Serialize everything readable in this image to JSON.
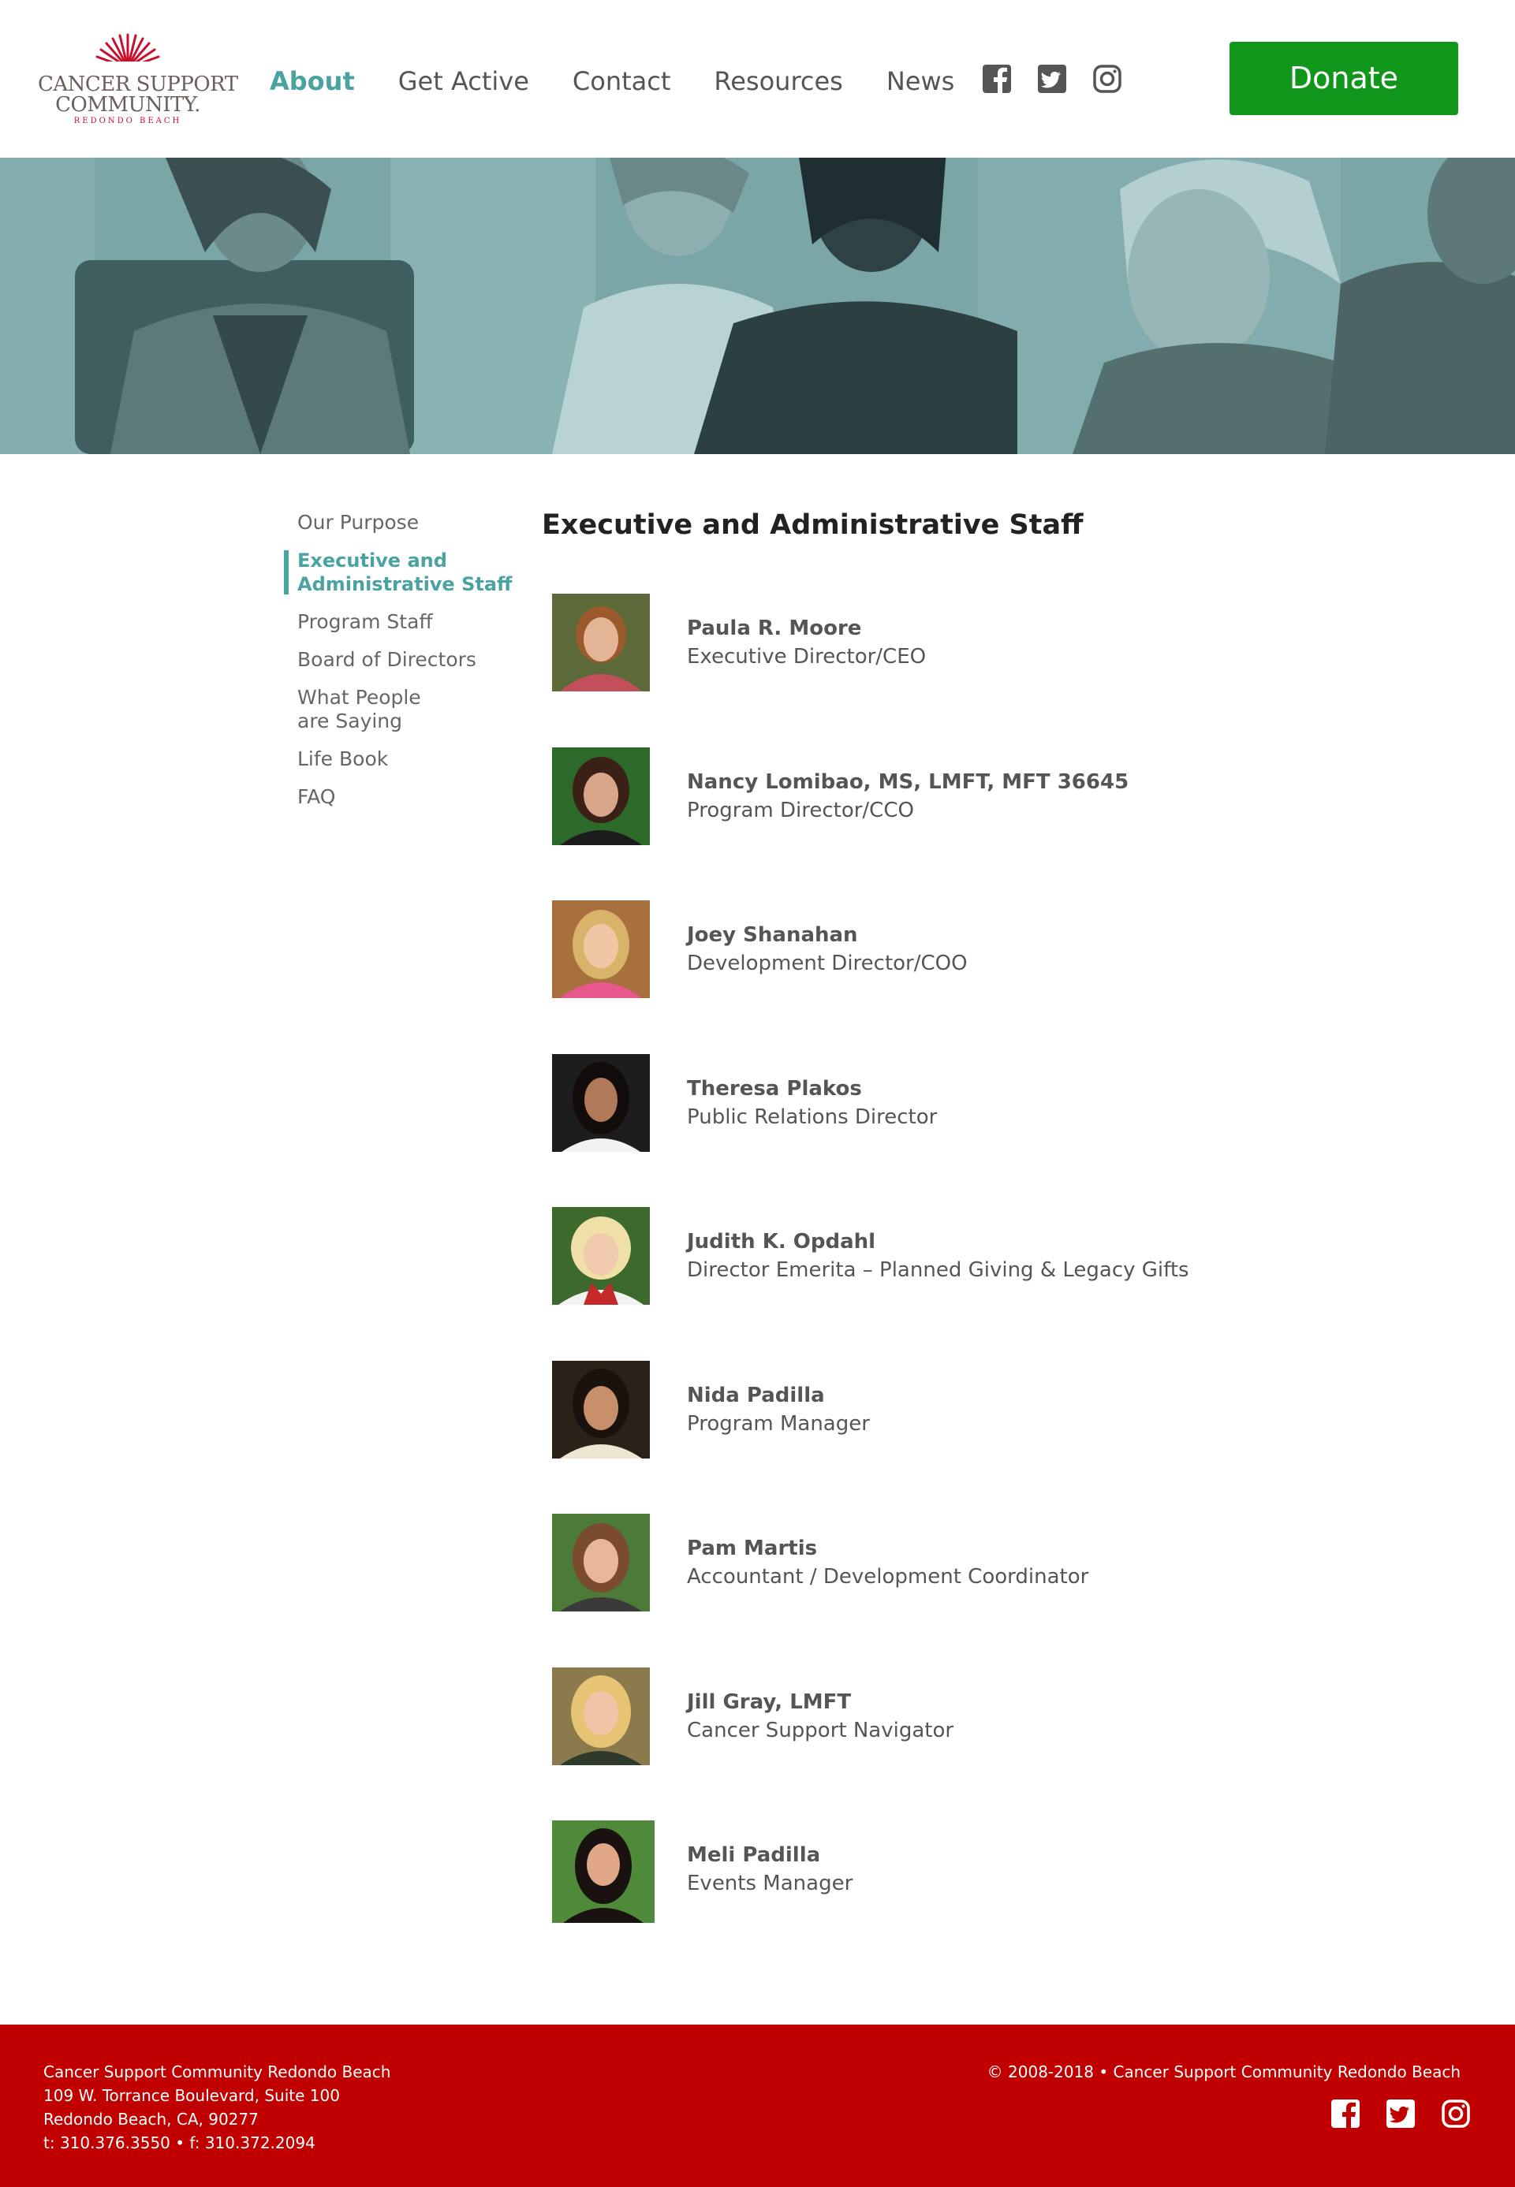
{
  "header": {
    "logo": {
      "line1": "CANCER SUPPORT",
      "line2": "COMMUNITY.",
      "line3": "REDONDO BEACH"
    },
    "nav": [
      {
        "label": "About",
        "active": true
      },
      {
        "label": "Get Active",
        "active": false
      },
      {
        "label": "Contact",
        "active": false
      },
      {
        "label": "Resources",
        "active": false
      },
      {
        "label": "News",
        "active": false
      }
    ],
    "social": [
      "facebook-icon",
      "twitter-icon",
      "instagram-icon"
    ],
    "donate_label": "Donate"
  },
  "sidebar": {
    "items": [
      {
        "label": "Our Purpose",
        "active": false
      },
      {
        "label": "Executive and\nAdministrative Staff",
        "active": true
      },
      {
        "label": "Program Staff",
        "active": false
      },
      {
        "label": "Board of Directors",
        "active": false
      },
      {
        "label": "What People\nare Saying",
        "active": false
      },
      {
        "label": "Life Book",
        "active": false
      },
      {
        "label": "FAQ",
        "active": false
      }
    ]
  },
  "main": {
    "title": "Executive and Administrative Staff",
    "staff": [
      {
        "name": "Paula R. Moore",
        "role": "Executive Director/CEO"
      },
      {
        "name": "Nancy Lomibao, MS, LMFT, MFT 36645",
        "role": "Program Director/CCO"
      },
      {
        "name": "Joey Shanahan",
        "role": "Development Director/COO"
      },
      {
        "name": "Theresa Plakos",
        "role": "Public Relations Director"
      },
      {
        "name": "Judith K. Opdahl",
        "role": "Director Emerita – Planned Giving & Legacy Gifts"
      },
      {
        "name": "Nida Padilla",
        "role": "Program Manager"
      },
      {
        "name": "Pam Martis",
        "role": "Accountant / Development Coordinator"
      },
      {
        "name": "Jill Gray, LMFT",
        "role": "Cancer Support Navigator"
      },
      {
        "name": "Meli Padilla",
        "role": "Events Manager"
      }
    ]
  },
  "footer": {
    "org": "Cancer Support Community Redondo Beach",
    "address1": "109 W. Torrance Boulevard, Suite 100",
    "address2": "Redondo Beach, CA, 90277",
    "phone": "t: 310.376.3550 • f: 310.372.2094",
    "copyright": "© 2008-2018 • Cancer Support Community Redondo Beach",
    "social": [
      "facebook-icon",
      "twitter-icon",
      "instagram-icon"
    ]
  },
  "colors": {
    "accent": "#4aa3a1",
    "donate": "#10961b",
    "footer": "#c00000",
    "logo_red": "#c8102e"
  }
}
